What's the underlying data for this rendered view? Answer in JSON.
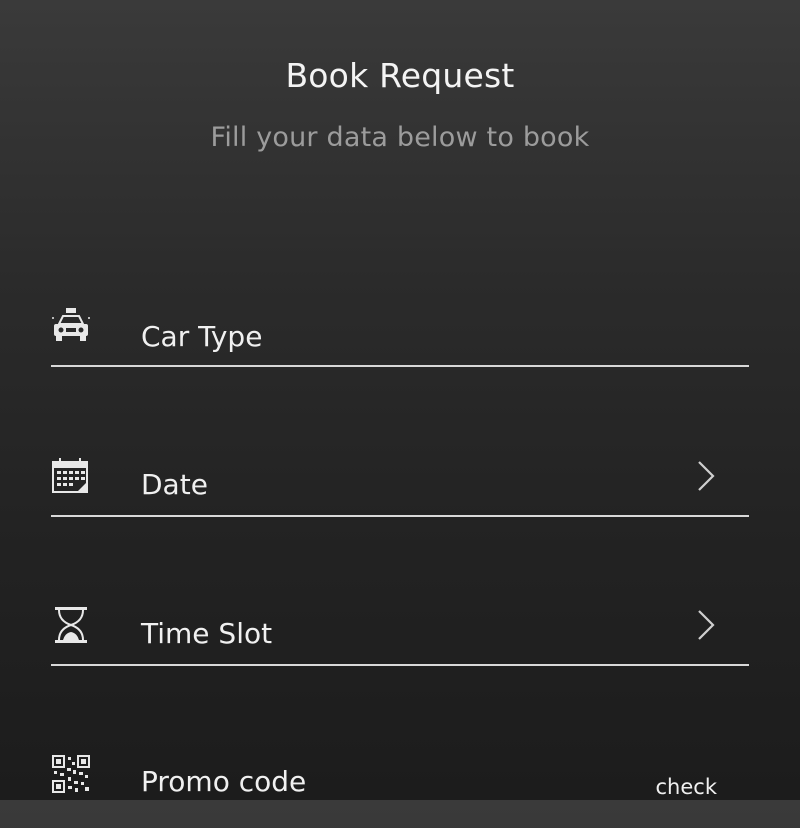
{
  "header": {
    "title": "Book Request",
    "subtitle": "Fill your data below to book"
  },
  "form": {
    "car_type": {
      "label": "Car Type",
      "icon": "taxi-icon"
    },
    "date": {
      "label": "Date",
      "icon": "calendar-icon"
    },
    "time_slot": {
      "label": "Time Slot",
      "icon": "hourglass-icon"
    },
    "promo_code": {
      "label": "Promo code",
      "icon": "qr-code-icon",
      "action_label": "check"
    }
  },
  "colors": {
    "background_top": "#3a3a3a",
    "background_bottom": "#1c1c1c",
    "text": "#f2f2f2",
    "subtitle": "#9c9c9c",
    "underline": "#d8d8d8"
  }
}
